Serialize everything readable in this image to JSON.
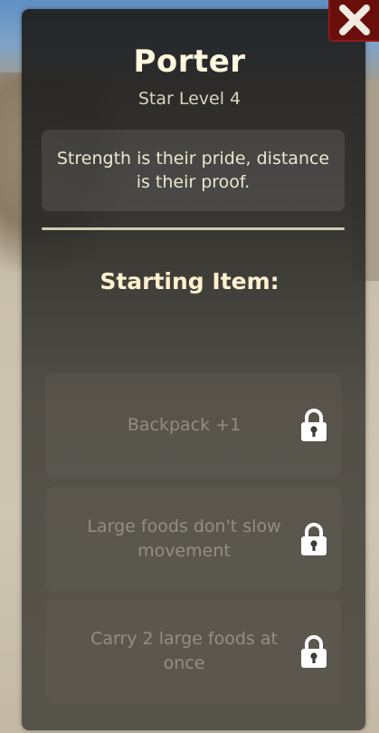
{
  "class_card": {
    "title": "Porter",
    "subtitle": "Star Level 4",
    "description": "Strength is their pride, distance is their proof."
  },
  "starting_item": {
    "heading": "Starting Item:"
  },
  "perks": [
    {
      "label": "Backpack +1",
      "state": "locked",
      "icon": "lock-icon"
    },
    {
      "label": "Large foods don't slow movement",
      "state": "locked",
      "icon": "lock-icon"
    },
    {
      "label": "Carry 2 large foods at once",
      "state": "locked",
      "icon": "lock-icon"
    }
  ],
  "close_button": {
    "icon": "close-icon"
  },
  "colors": {
    "close_button_bg": "#6a0e0c",
    "title_text": "#fff8de",
    "heading_text": "#fff1cf"
  }
}
